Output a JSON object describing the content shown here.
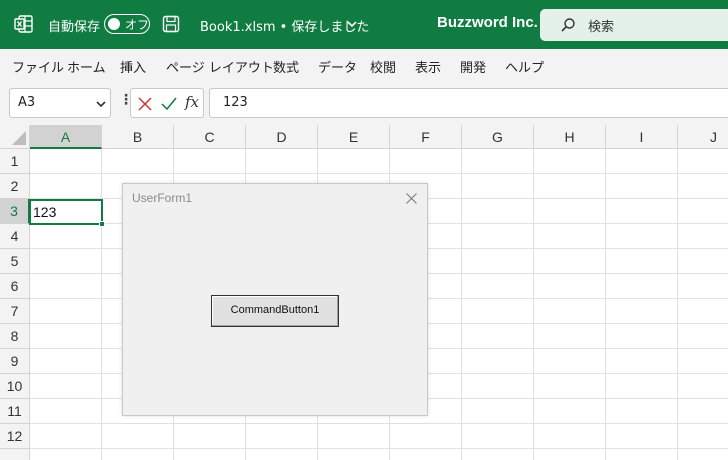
{
  "titlebar": {
    "app_icon": "excel-icon",
    "autosave_label": "自動保存",
    "autosave_state": "オフ",
    "filename": "Book1.xlsm • 保存しました",
    "company": "Buzzword Inc.",
    "search_placeholder": "検索",
    "colors": {
      "background": "#107c41",
      "search_bg": "#e4f1e9"
    }
  },
  "menu": {
    "items": [
      "ファイル",
      "ホーム",
      "挿入",
      "ページ レイアウト",
      "数式",
      "データ",
      "校閲",
      "表示",
      "開発",
      "ヘルプ"
    ]
  },
  "formula_bar": {
    "name_box": "A3",
    "dots": "⋮",
    "fx": "fx",
    "value": "123"
  },
  "grid": {
    "columns": [
      "A",
      "B",
      "C",
      "D",
      "E",
      "F",
      "G",
      "H",
      "I",
      "J"
    ],
    "rows": [
      "1",
      "2",
      "3",
      "4",
      "5",
      "6",
      "7",
      "8",
      "9",
      "10",
      "11",
      "12"
    ],
    "selected_column": "A",
    "selected_row": "3",
    "cells": {
      "A3": "123"
    },
    "accent_color": "#107c41"
  },
  "userform": {
    "title": "UserForm1",
    "button_label": "CommandButton1"
  }
}
